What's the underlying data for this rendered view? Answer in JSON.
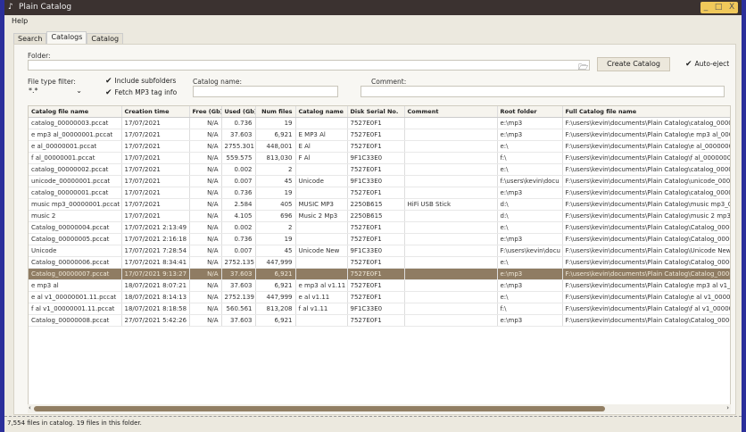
{
  "window": {
    "title": "Plain Catalog",
    "minimize": "_",
    "maximize": "□",
    "close": "X"
  },
  "menu": {
    "help": "Help"
  },
  "tabs": [
    "Search",
    "Catalogs",
    "Catalog"
  ],
  "form": {
    "folder_label": "Folder:",
    "folder_value": "",
    "create_button": "Create Catalog",
    "auto_eject": "Auto-eject",
    "file_type_label": "File type filter:",
    "file_type_value": "*.*",
    "include_subfolders": "Include subfolders",
    "fetch_mp3": "Fetch MP3 tag info",
    "catalog_name_label": "Catalog name:",
    "comment_label": "Comment:"
  },
  "table": {
    "columns": [
      "Catalog file name",
      "Creation time",
      "Free (Gb)",
      "Used (Gb)",
      "Num files",
      "Catalog name",
      "Disk Serial No.",
      "Comment",
      "Root folder",
      "Full Catalog file name"
    ],
    "rows": [
      [
        "catalog_00000003.pccat",
        "17/07/2021",
        "N/A",
        "0.736",
        "19",
        "",
        "7527E0F1",
        "",
        "e:\\mp3",
        "F:\\users\\kevin\\documents\\Plain Catalog\\catalog_00000003.pccat"
      ],
      [
        "e mp3 al_00000001.pccat",
        "17/07/2021",
        "N/A",
        "37.603",
        "6,921",
        "E MP3 Al",
        "7527E0F1",
        "",
        "e:\\mp3",
        "F:\\users\\kevin\\documents\\Plain Catalog\\e mp3 al_00000001.pccat"
      ],
      [
        "e al_00000001.pccat",
        "17/07/2021",
        "N/A",
        "2755.301",
        "448,001",
        "E Al",
        "7527E0F1",
        "",
        "e:\\",
        "F:\\users\\kevin\\documents\\Plain Catalog\\e al_00000001.pccat"
      ],
      [
        "f al_00000001.pccat",
        "17/07/2021",
        "N/A",
        "559.575",
        "813,030",
        "F Al",
        "9F1C33E0",
        "",
        "f:\\",
        "F:\\users\\kevin\\documents\\Plain Catalog\\f al_00000001.pccat"
      ],
      [
        "catalog_00000002.pccat",
        "17/07/2021",
        "N/A",
        "0.002",
        "2",
        "",
        "7527E0F1",
        "",
        "e:\\",
        "F:\\users\\kevin\\documents\\Plain Catalog\\catalog_00000002.pccat"
      ],
      [
        "unicode_00000001.pccat",
        "17/07/2021",
        "N/A",
        "0.007",
        "45",
        "Unicode",
        "9F1C33E0",
        "",
        "f:\\users\\kevin\\docu",
        "F:\\users\\kevin\\documents\\Plain Catalog\\unicode_00000001.pccat"
      ],
      [
        "catalog_00000001.pccat",
        "17/07/2021",
        "N/A",
        "0.736",
        "19",
        "",
        "7527E0F1",
        "",
        "e:\\mp3",
        "F:\\users\\kevin\\documents\\Plain Catalog\\catalog_00000001.pccat"
      ],
      [
        "music mp3_00000001.pccat",
        "17/07/2021",
        "N/A",
        "2.584",
        "405",
        "MUSIC MP3",
        "2250B615",
        "HiFi USB Stick",
        "d:\\",
        "F:\\users\\kevin\\documents\\Plain Catalog\\music mp3_00000001.pccat"
      ],
      [
        "music 2",
        "17/07/2021",
        "N/A",
        "4.105",
        "696",
        "Music 2 Mp3",
        "2250B615",
        "",
        "d:\\",
        "F:\\users\\kevin\\documents\\Plain Catalog\\music 2 mp3_"
      ],
      [
        "Catalog_00000004.pccat",
        "17/07/2021 2:13:49",
        "N/A",
        "0.002",
        "2",
        "",
        "7527E0F1",
        "",
        "e:\\",
        "F:\\users\\kevin\\documents\\Plain Catalog\\Catalog_00000004.pccat"
      ],
      [
        "Catalog_00000005.pccat",
        "17/07/2021 2:16:18",
        "N/A",
        "0.736",
        "19",
        "",
        "7527E0F1",
        "",
        "e:\\mp3",
        "F:\\users\\kevin\\documents\\Plain Catalog\\Catalog_00000005.pccat"
      ],
      [
        "Unicode",
        "17/07/2021 7:28:54",
        "N/A",
        "0.007",
        "45",
        "Unicode New",
        "9F1C33E0",
        "",
        "F:\\users\\kevin\\docu",
        "F:\\users\\kevin\\documents\\Plain Catalog\\Unicode New_"
      ],
      [
        "Catalog_00000006.pccat",
        "17/07/2021 8:34:41",
        "N/A",
        "2752.135",
        "447,999",
        "",
        "7527E0F1",
        "",
        "e:\\",
        "F:\\users\\kevin\\documents\\Plain Catalog\\Catalog_00000006.pccat"
      ],
      [
        "Catalog_00000007.pccat",
        "17/07/2021 9:13:27",
        "N/A",
        "37.603",
        "6,921",
        "",
        "7527E0F1",
        "",
        "e:\\mp3",
        "F:\\users\\kevin\\documents\\Plain Catalog\\Catalog_00000007.pccat"
      ],
      [
        "e mp3 al",
        "18/07/2021 8:07:21",
        "N/A",
        "37.603",
        "6,921",
        "e mp3 al v1.11",
        "7527E0F1",
        "",
        "e:\\mp3",
        "F:\\users\\kevin\\documents\\Plain Catalog\\e mp3 al v1_"
      ],
      [
        "e al v1_00000001.11.pccat",
        "18/07/2021 8:14:13",
        "N/A",
        "2752.139",
        "447,999",
        "e al v1.11",
        "7527E0F1",
        "",
        "e:\\",
        "F:\\users\\kevin\\documents\\Plain Catalog\\e al v1_00000001.11.pccat"
      ],
      [
        "f al v1_00000001.11.pccat",
        "18/07/2021 8:18:58",
        "N/A",
        "560.561",
        "813,208",
        "f al v1.11",
        "9F1C33E0",
        "",
        "f:\\",
        "F:\\users\\kevin\\documents\\Plain Catalog\\f al v1_00000001.11.pccat"
      ],
      [
        "Catalog_00000008.pccat",
        "27/07/2021 5:42:26",
        "N/A",
        "37.603",
        "6,921",
        "",
        "7527E0F1",
        "",
        "e:\\mp3",
        "F:\\users\\kevin\\documents\\Plain Catalog\\Catalog_00000008.pccat"
      ]
    ],
    "selected_row": 13
  },
  "status": "7,554 files in catalog.  19 files in this folder."
}
